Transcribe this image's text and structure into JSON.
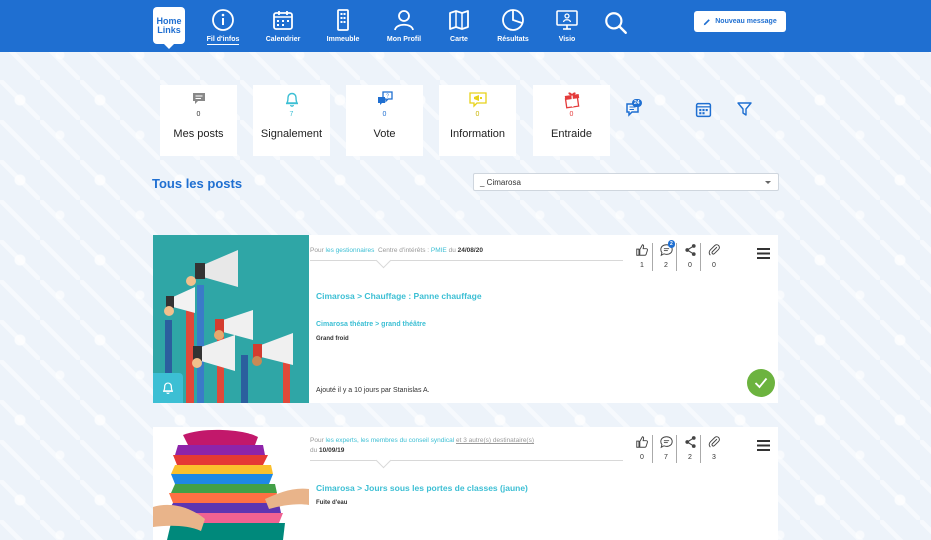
{
  "app": {
    "logo_line1": "Home",
    "logo_line2": "Links"
  },
  "nav": [
    {
      "label": "Fil d'infos",
      "icon": "info-icon",
      "active": true
    },
    {
      "label": "Calendrier",
      "icon": "calendar-icon"
    },
    {
      "label": "Immeuble",
      "icon": "building-icon"
    },
    {
      "label": "Mon Profil",
      "icon": "user-icon"
    },
    {
      "label": "Carte",
      "icon": "map-icon"
    },
    {
      "label": "Résultats",
      "icon": "pie-chart-icon"
    },
    {
      "label": "Visio",
      "icon": "video-screen-icon"
    }
  ],
  "new_message": {
    "label": "Nouveau message",
    "icon": "pencil-icon"
  },
  "filters": [
    {
      "label": "Mes posts",
      "count": "0",
      "icon": "speech-bubble-icon",
      "color": "#777777"
    },
    {
      "label": "Signalement",
      "count": "7",
      "icon": "bell-icon",
      "color": "#3cbfd4"
    },
    {
      "label": "Vote",
      "count": "0",
      "icon": "vote-bubbles-icon",
      "color": "#1f6fd1"
    },
    {
      "label": "Information",
      "count": "0",
      "icon": "megaphone-icon",
      "color": "#e8d21a"
    },
    {
      "label": "Entraide",
      "count": "0",
      "icon": "gift-icon",
      "color": "#e43b3b"
    }
  ],
  "toolbar": {
    "chat_badge": "24"
  },
  "section_title": "Tous les posts",
  "building_select": {
    "value": "_ Cimarosa"
  },
  "posts": [
    {
      "meta_for": "Pour",
      "recipients": "les gestionnaires",
      "interest_label": "Centre d'intérêts :",
      "interest": "PMIE",
      "date_prefix": "du",
      "date": "24/08/20",
      "title": "Cimarosa > Chauffage : Panne chauffage",
      "tags": "Cimarosa  théatre > grand théâtre",
      "description": "Grand froid",
      "footer": "Ajouté il y a 10 jours par Stanislas A.",
      "likes": "1",
      "comments": "2",
      "comments_badge": "2",
      "shares": "0",
      "attachments": "0",
      "type_icon": "bell-icon",
      "resolved": true
    },
    {
      "meta_for": "Pour",
      "recipients": "les experts, les membres du conseil syndical",
      "others": "et 3 autre(s) destinataire(s)",
      "date_prefix": "du",
      "date": "10/09/19",
      "title": "Cimarosa > Jours sous les portes de classes (jaune)",
      "description": "Fuite d'eau",
      "likes": "0",
      "comments": "7",
      "shares": "2",
      "attachments": "3"
    }
  ],
  "colors": {
    "brand": "#1f6fd1",
    "accent": "#3cbfd4",
    "success": "#6cb33f"
  }
}
